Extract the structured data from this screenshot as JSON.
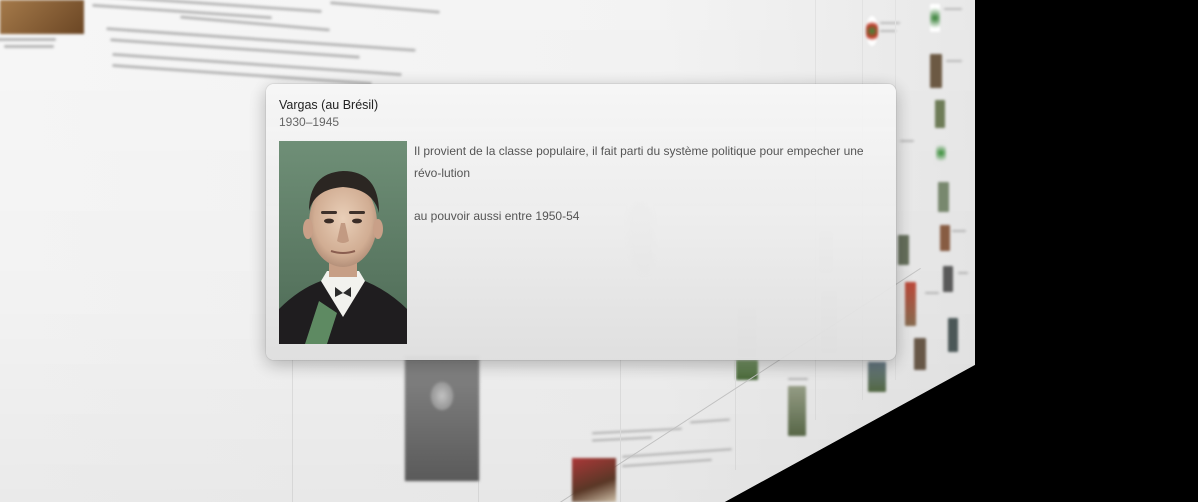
{
  "popup": {
    "title": "Vargas (au Brésil)",
    "dates": "1930–1945",
    "paragraphs": [
      "Il provient de la classe populaire, il fait parti du système politique pour empecher une révo-lution",
      "au pouvoir aussi entre 1950-54"
    ],
    "image": "portrait-vargas"
  },
  "background": {
    "view": "timeline-3d-wall",
    "thumbnails": [
      "portrait-photo",
      "map-thumbnail",
      "group-photo"
    ]
  }
}
